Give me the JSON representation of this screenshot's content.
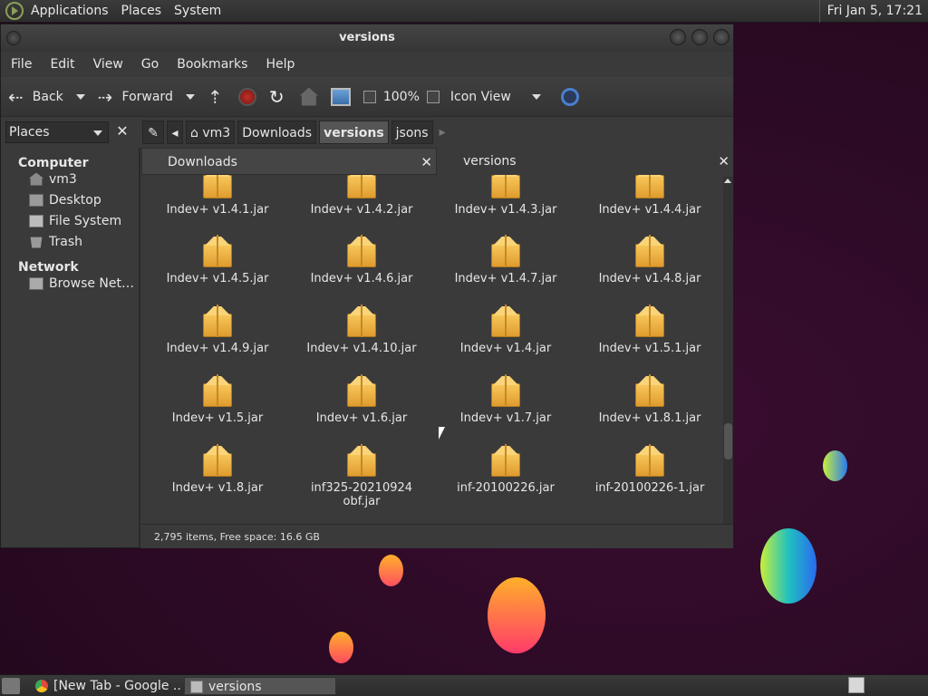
{
  "top_panel": {
    "menus": [
      "Applications",
      "Places",
      "System"
    ],
    "clock": "Fri Jan  5, 17:21"
  },
  "window": {
    "title": "versions",
    "menubar": [
      "File",
      "Edit",
      "View",
      "Go",
      "Bookmarks",
      "Help"
    ],
    "toolbar": {
      "back": "Back",
      "forward": "Forward",
      "zoom": "100%",
      "view_mode": "Icon View"
    },
    "location": {
      "places_select": "Places",
      "crumbs": [
        "vm3",
        "Downloads",
        "versions",
        "jsons"
      ],
      "active_crumb": "versions"
    },
    "sidebar": {
      "computer_heading": "Computer",
      "computer_items": [
        "vm3",
        "Desktop",
        "File System",
        "Trash"
      ],
      "network_heading": "Network",
      "network_items": [
        "Browse Net…"
      ]
    },
    "tabs": [
      {
        "label": "Downloads",
        "active": false
      },
      {
        "label": "versions",
        "active": true
      }
    ],
    "files": [
      "Indev+ v1.4.1.jar",
      "Indev+ v1.4.2.jar",
      "Indev+ v1.4.3.jar",
      "Indev+ v1.4.4.jar",
      "Indev+ v1.4.5.jar",
      "Indev+ v1.4.6.jar",
      "Indev+ v1.4.7.jar",
      "Indev+ v1.4.8.jar",
      "Indev+ v1.4.9.jar",
      "Indev+ v1.4.10.jar",
      "Indev+ v1.4.jar",
      "Indev+ v1.5.1.jar",
      "Indev+ v1.5.jar",
      "Indev+ v1.6.jar",
      "Indev+ v1.7.jar",
      "Indev+ v1.8.1.jar",
      "Indev+ v1.8.jar",
      "inf325-20210924 obf.jar",
      "inf-20100226.jar",
      "inf-20100226-1.jar"
    ],
    "status": "2,795 items, Free space: 16.6 GB"
  },
  "taskbar": {
    "tasks": [
      "[New Tab - Google ...",
      "versions"
    ]
  },
  "colors": {
    "folder_box": "#f0b548",
    "window_bg": "#3a3a3a",
    "desktop_bg": "#2a0a24"
  }
}
